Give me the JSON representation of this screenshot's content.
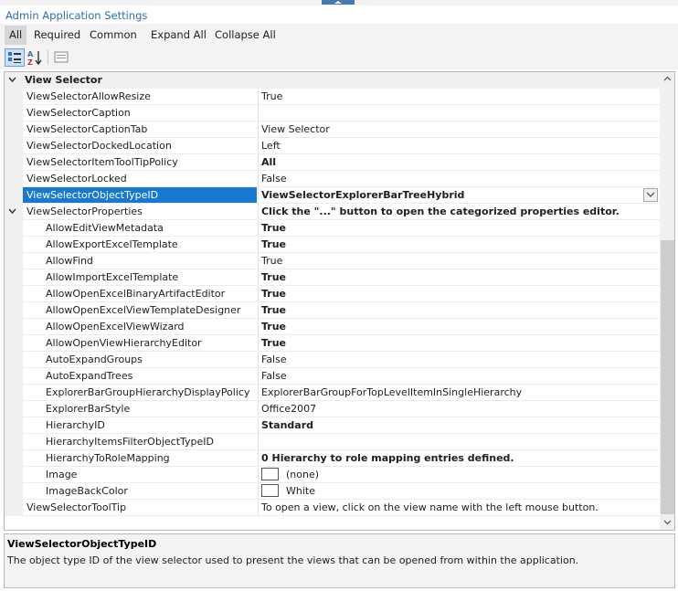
{
  "panel": {
    "title": "Admin Application Settings"
  },
  "filters": [
    "All",
    "Required",
    "Common",
    "Expand All",
    "Collapse All"
  ],
  "category": "View Selector",
  "rows": [
    {
      "name": "ViewSelectorAllowResize",
      "value": "True",
      "bold": false
    },
    {
      "name": "ViewSelectorCaption",
      "value": "",
      "bold": false
    },
    {
      "name": "ViewSelectorCaptionTab",
      "value": "View Selector",
      "bold": false
    },
    {
      "name": "ViewSelectorDockedLocation",
      "value": "Left",
      "bold": false
    },
    {
      "name": "ViewSelectorItemToolTipPolicy",
      "value": "All",
      "bold": true
    },
    {
      "name": "ViewSelectorLocked",
      "value": "False",
      "bold": false
    },
    {
      "name": "ViewSelectorObjectTypeID",
      "value": "ViewSelectorExplorerBarTreeHybrid",
      "bold": true
    },
    {
      "name": "ViewSelectorProperties",
      "value": "Click the \"...\" button to open the categorized properties editor.",
      "bold": true
    },
    {
      "name": "AllowEditViewMetadata",
      "value": "True",
      "bold": true
    },
    {
      "name": "AllowExportExcelTemplate",
      "value": "True",
      "bold": true
    },
    {
      "name": "AllowFind",
      "value": "True",
      "bold": false
    },
    {
      "name": "AllowImportExcelTemplate",
      "value": "True",
      "bold": true
    },
    {
      "name": "AllowOpenExcelBinaryArtifactEditor",
      "value": "True",
      "bold": true
    },
    {
      "name": "AllowOpenExcelViewTemplateDesigner",
      "value": "True",
      "bold": true
    },
    {
      "name": "AllowOpenExcelViewWizard",
      "value": "True",
      "bold": true
    },
    {
      "name": "AllowOpenViewHierarchyEditor",
      "value": "True",
      "bold": true
    },
    {
      "name": "AutoExpandGroups",
      "value": "False",
      "bold": false
    },
    {
      "name": "AutoExpandTrees",
      "value": "False",
      "bold": false
    },
    {
      "name": "ExplorerBarGroupHierarchyDisplayPolicy",
      "value": "ExplorerBarGroupForTopLevelItemInSingleHierarchy",
      "bold": false
    },
    {
      "name": "ExplorerBarStyle",
      "value": "Office2007",
      "bold": false
    },
    {
      "name": "HierarchyID",
      "value": "Standard",
      "bold": true
    },
    {
      "name": "HierarchyItemsFilterObjectTypeID",
      "value": "",
      "bold": false
    },
    {
      "name": "HierarchyToRoleMapping",
      "value": "0 Hierarchy to role mapping entries defined.",
      "bold": true
    },
    {
      "name": "Image",
      "value": "(none)",
      "bold": false
    },
    {
      "name": "ImageBackColor",
      "value": "White",
      "bold": false
    },
    {
      "name": "ViewSelectorToolTip",
      "value": "To open a view, click on the view name with the left mouse button.",
      "bold": false
    }
  ],
  "description": {
    "title": "ViewSelectorObjectTypeID",
    "text": "The object type ID of the view selector used to present the views that can be opened from within the application."
  },
  "colors": {
    "selection": "#1979d0",
    "title": "#2e6cb5"
  }
}
